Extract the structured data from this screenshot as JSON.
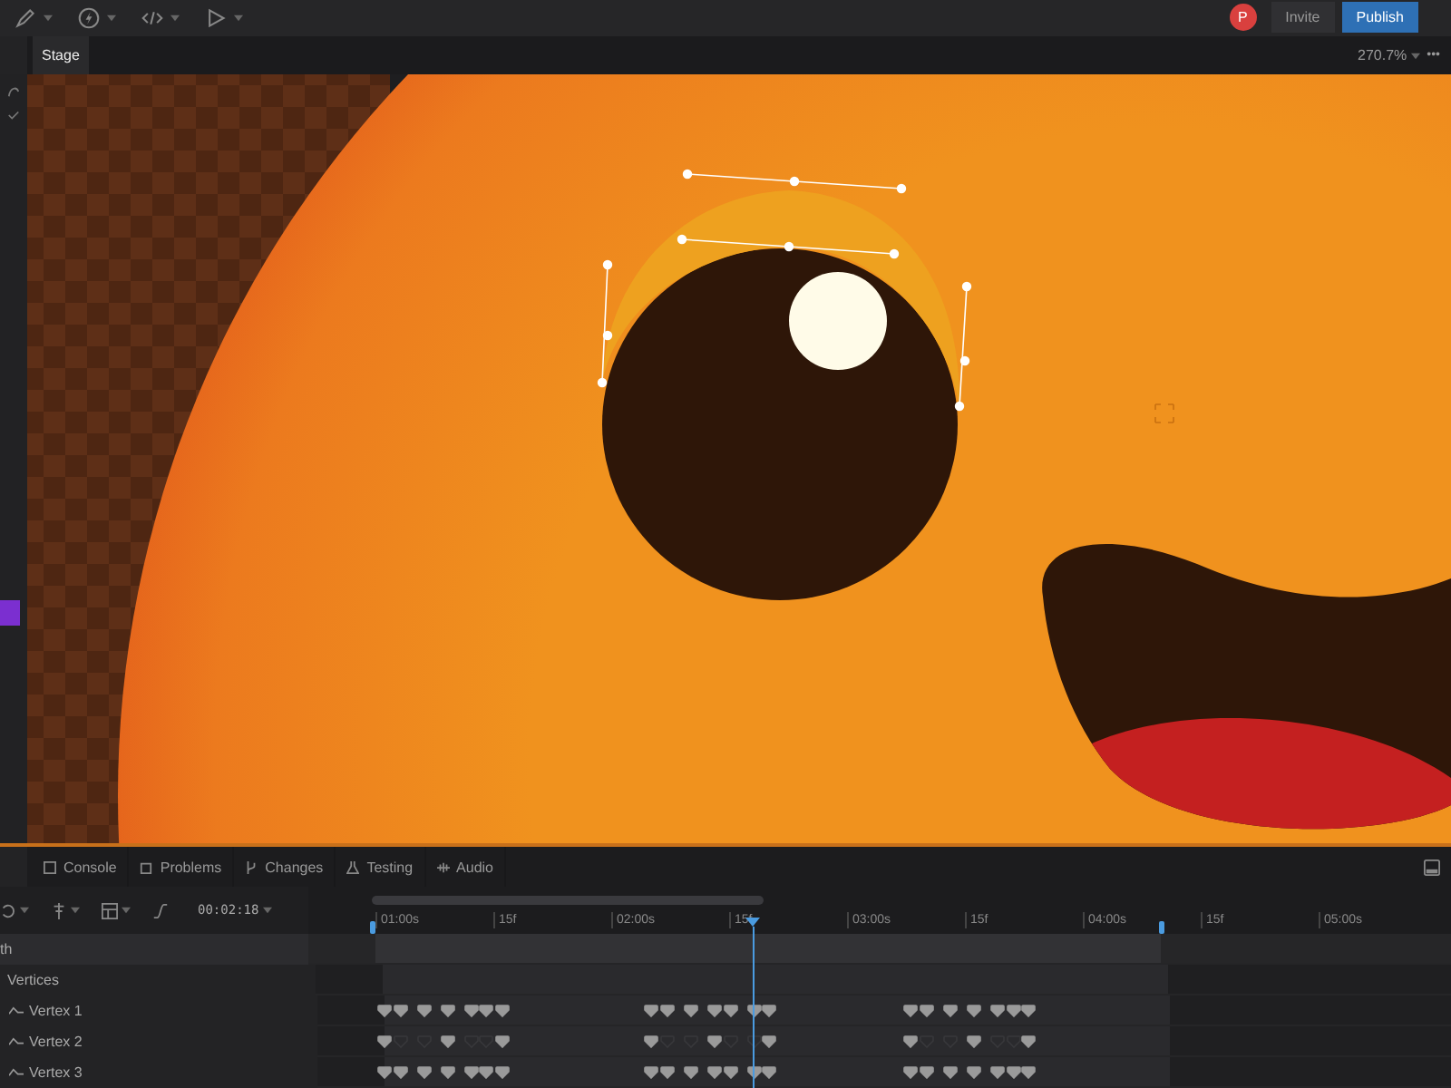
{
  "topbar": {
    "avatar": "P",
    "buttons": [
      {
        "label": "Invite",
        "kind": "plain"
      },
      {
        "label": "Publish",
        "kind": "primary"
      }
    ]
  },
  "stage": {
    "tabs": [
      {
        "label": "Stage",
        "selected": true
      }
    ],
    "zoom": "270.7%",
    "menu": "•••"
  },
  "panel_tabs": [
    {
      "label": "Console"
    },
    {
      "label": "Problems"
    },
    {
      "label": "Changes"
    },
    {
      "label": "Testing"
    },
    {
      "label": "Audio"
    }
  ],
  "timeline": {
    "timecode": "00:02:18",
    "ruler": [
      "01:00s",
      "15f",
      "02:00s",
      "15f",
      "03:00s",
      "15f",
      "04:00s",
      "15f",
      "05:00s"
    ],
    "tracks": [
      {
        "label": "th",
        "kind": "group"
      },
      {
        "label": "Vertices",
        "kind": "folder"
      },
      {
        "label": "Vertex 1",
        "kind": "vertex",
        "keyframes": [
          {
            "set": true
          },
          {
            "set": true
          },
          {
            "set": true
          },
          {
            "set": true
          },
          {
            "set": true
          },
          {
            "set": true
          },
          {
            "set": true
          },
          {
            "set": true
          },
          {
            "set": true
          },
          {
            "set": true
          },
          {
            "set": true
          },
          {
            "set": true
          },
          {
            "set": true
          },
          {
            "set": true
          },
          {
            "set": true
          },
          {
            "set": true
          },
          {
            "set": true
          },
          {
            "set": true
          },
          {
            "set": true
          },
          {
            "set": true
          },
          {
            "set": true
          }
        ]
      },
      {
        "label": "Vertex 2",
        "kind": "vertex",
        "keyframes": [
          {
            "set": true
          },
          {
            "set": false
          },
          {
            "set": false
          },
          {
            "set": true
          },
          {
            "set": false
          },
          {
            "set": false
          },
          {
            "set": true
          },
          {
            "set": true
          },
          {
            "set": false
          },
          {
            "set": false
          },
          {
            "set": true
          },
          {
            "set": false
          },
          {
            "set": false
          },
          {
            "set": true
          },
          {
            "set": true
          },
          {
            "set": false
          },
          {
            "set": false
          },
          {
            "set": true
          },
          {
            "set": false
          },
          {
            "set": false
          },
          {
            "set": true
          }
        ]
      },
      {
        "label": "Vertex 3",
        "kind": "vertex",
        "keyframes": [
          {
            "set": true
          },
          {
            "set": true
          },
          {
            "set": true
          },
          {
            "set": true
          },
          {
            "set": true
          },
          {
            "set": true
          },
          {
            "set": true
          },
          {
            "set": true
          },
          {
            "set": true
          },
          {
            "set": true
          },
          {
            "set": true
          },
          {
            "set": true
          },
          {
            "set": true
          },
          {
            "set": true
          },
          {
            "set": true
          },
          {
            "set": true
          },
          {
            "set": true
          },
          {
            "set": true
          },
          {
            "set": true
          },
          {
            "set": true
          },
          {
            "set": true
          }
        ]
      }
    ]
  }
}
